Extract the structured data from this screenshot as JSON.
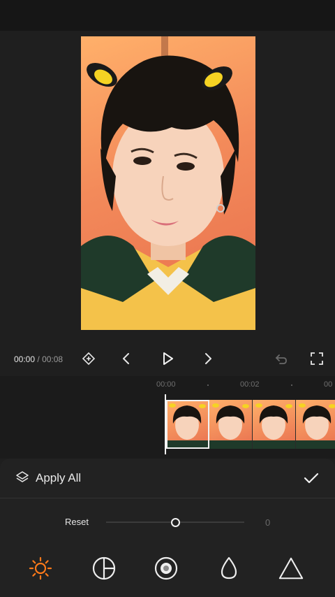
{
  "player": {
    "current_time": "00:00",
    "separator": "/",
    "duration": "00:08"
  },
  "timeline": {
    "ruler": [
      "00:00",
      "00:02",
      "00"
    ]
  },
  "adjust_panel": {
    "apply_all_label": "Apply All",
    "reset_label": "Reset",
    "slider_value": "0",
    "slider_level": 0.5
  },
  "tools": [
    {
      "icon": "brightness-icon",
      "active": true
    },
    {
      "icon": "contrast-icon",
      "active": false
    },
    {
      "icon": "saturation-icon",
      "active": false
    },
    {
      "icon": "droplet-icon",
      "active": false
    },
    {
      "icon": "triangle-icon",
      "active": false
    }
  ],
  "colors": {
    "accent": "#ff7a1a",
    "background": "#1f1f1f",
    "panel": "#222222"
  }
}
